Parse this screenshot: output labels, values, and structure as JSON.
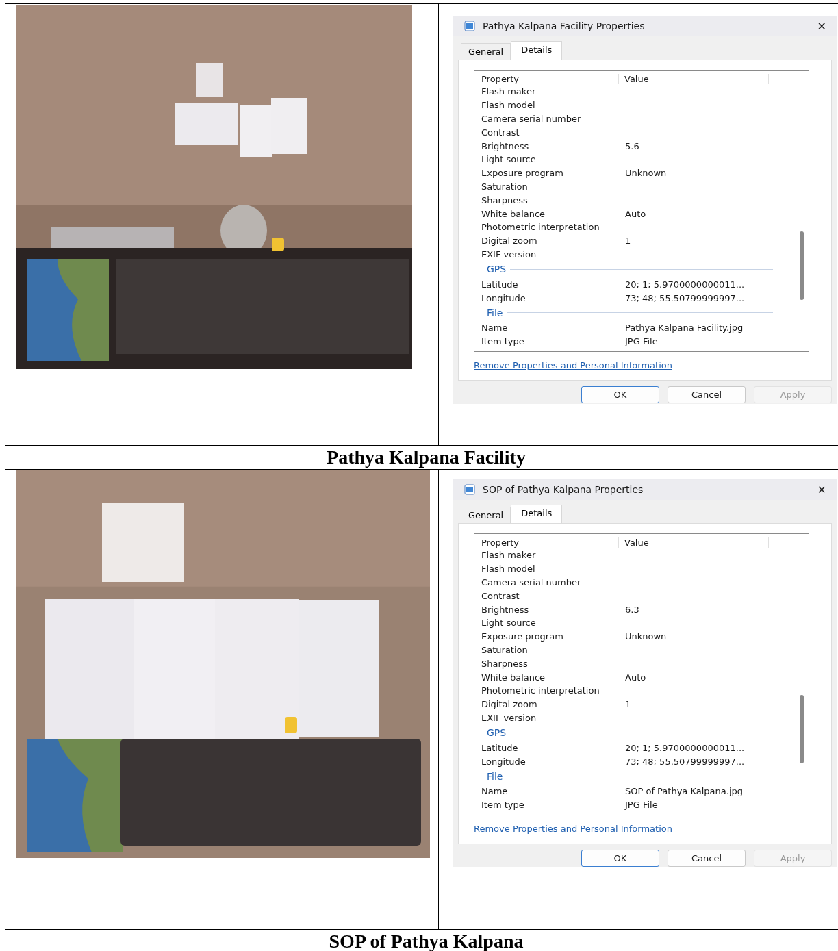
{
  "sections": [
    {
      "dialog": {
        "title": "Pathya Kalpana Facility Properties",
        "close": "✕",
        "tabs": [
          {
            "label": "General",
            "selected": false
          },
          {
            "label": "Details",
            "selected": true
          }
        ],
        "columns": [
          "Property",
          "Value"
        ],
        "rows": [
          {
            "kind": "row",
            "property": "Flash maker",
            "value": ""
          },
          {
            "kind": "row",
            "property": "Flash model",
            "value": ""
          },
          {
            "kind": "row",
            "property": "Camera serial number",
            "value": ""
          },
          {
            "kind": "row",
            "property": "Contrast",
            "value": ""
          },
          {
            "kind": "row",
            "property": "Brightness",
            "value": "5.6"
          },
          {
            "kind": "row",
            "property": "Light source",
            "value": ""
          },
          {
            "kind": "row",
            "property": "Exposure program",
            "value": "Unknown"
          },
          {
            "kind": "row",
            "property": "Saturation",
            "value": ""
          },
          {
            "kind": "row",
            "property": "Sharpness",
            "value": ""
          },
          {
            "kind": "row",
            "property": "White balance",
            "value": "Auto"
          },
          {
            "kind": "row",
            "property": "Photometric interpretation",
            "value": ""
          },
          {
            "kind": "row",
            "property": "Digital zoom",
            "value": "1"
          },
          {
            "kind": "row",
            "property": "EXIF version",
            "value": ""
          },
          {
            "kind": "group",
            "property": "GPS"
          },
          {
            "kind": "row",
            "property": "Latitude",
            "value": "20; 1; 5.9700000000011..."
          },
          {
            "kind": "row",
            "property": "Longitude",
            "value": "73; 48; 55.50799999997..."
          },
          {
            "kind": "group",
            "property": "File"
          },
          {
            "kind": "row",
            "property": "Name",
            "value": "Pathya Kalpana Facility.jpg"
          },
          {
            "kind": "row",
            "property": "Item type",
            "value": "JPG File"
          }
        ],
        "link": "Remove Properties and Personal Information",
        "buttons": [
          {
            "label": "OK",
            "default": true,
            "disabled": false
          },
          {
            "label": "Cancel",
            "default": false,
            "disabled": false
          },
          {
            "label": "Apply",
            "default": false,
            "disabled": true
          }
        ]
      },
      "caption": "Pathya Kalpana Facility"
    },
    {
      "dialog": {
        "title": "SOP of Pathya Kalpana Properties",
        "close": "✕",
        "tabs": [
          {
            "label": "General",
            "selected": false
          },
          {
            "label": "Details",
            "selected": true
          }
        ],
        "columns": [
          "Property",
          "Value"
        ],
        "rows": [
          {
            "kind": "row",
            "property": "Flash maker",
            "value": ""
          },
          {
            "kind": "row",
            "property": "Flash model",
            "value": ""
          },
          {
            "kind": "row",
            "property": "Camera serial number",
            "value": ""
          },
          {
            "kind": "row",
            "property": "Contrast",
            "value": ""
          },
          {
            "kind": "row",
            "property": "Brightness",
            "value": "6.3"
          },
          {
            "kind": "row",
            "property": "Light source",
            "value": ""
          },
          {
            "kind": "row",
            "property": "Exposure program",
            "value": "Unknown"
          },
          {
            "kind": "row",
            "property": "Saturation",
            "value": ""
          },
          {
            "kind": "row",
            "property": "Sharpness",
            "value": ""
          },
          {
            "kind": "row",
            "property": "White balance",
            "value": "Auto"
          },
          {
            "kind": "row",
            "property": "Photometric interpretation",
            "value": ""
          },
          {
            "kind": "row",
            "property": "Digital zoom",
            "value": "1"
          },
          {
            "kind": "row",
            "property": "EXIF version",
            "value": ""
          },
          {
            "kind": "group",
            "property": "GPS"
          },
          {
            "kind": "row",
            "property": "Latitude",
            "value": "20; 1; 5.9700000000011..."
          },
          {
            "kind": "row",
            "property": "Longitude",
            "value": "73; 48; 55.50799999997..."
          },
          {
            "kind": "group",
            "property": "File"
          },
          {
            "kind": "row",
            "property": "Name",
            "value": "SOP of Pathya Kalpana.jpg"
          },
          {
            "kind": "row",
            "property": "Item type",
            "value": "JPG File"
          }
        ],
        "link": "Remove Properties and Personal Information",
        "buttons": [
          {
            "label": "OK",
            "default": true,
            "disabled": false
          },
          {
            "label": "Cancel",
            "default": false,
            "disabled": false
          },
          {
            "label": "Apply",
            "default": false,
            "disabled": true
          }
        ]
      },
      "caption": "SOP of Pathya Kalpana"
    }
  ]
}
